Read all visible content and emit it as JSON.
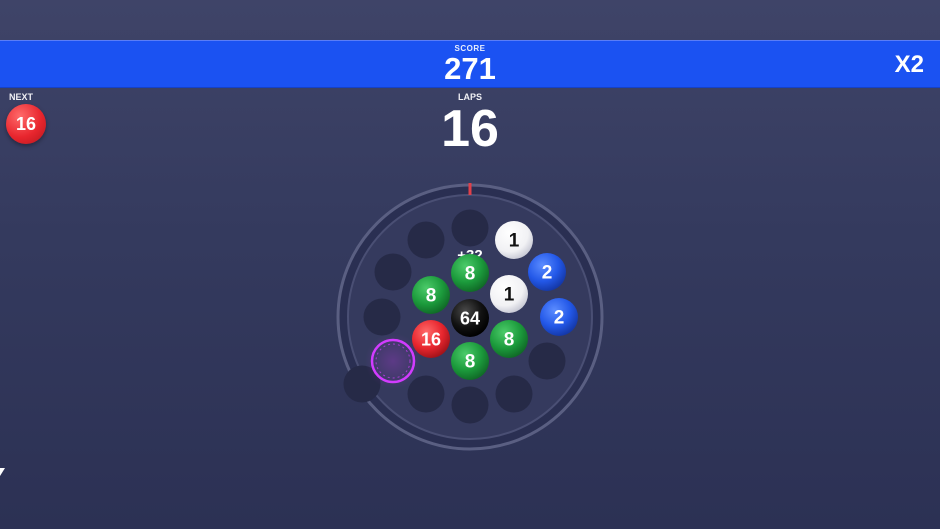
{
  "score": {
    "label": "SCORE",
    "value": "271"
  },
  "multiplier": "X2",
  "next": {
    "label": "NEXT",
    "value": "16",
    "color": "#e8262e"
  },
  "laps": {
    "label": "LAPS",
    "value": "16"
  },
  "bonus_text": "+32",
  "colors": {
    "background": "#363b60",
    "score_bar": "#1b52f2",
    "ball_white": "#ffffff",
    "ball_blue": "#2358e8",
    "ball_green": "#1c9b3c",
    "ball_red": "#e8262e",
    "ball_black": "#111111",
    "ring_glow": "#d23cff",
    "marker": "#e0404a"
  },
  "balls": [
    {
      "label": "1",
      "color": "white"
    },
    {
      "label": "2",
      "color": "blue"
    },
    {
      "label": "8",
      "color": "green"
    },
    {
      "label": "8",
      "color": "green"
    },
    {
      "label": "1",
      "color": "white"
    },
    {
      "label": "64",
      "color": "black"
    },
    {
      "label": "2",
      "color": "blue"
    },
    {
      "label": "16",
      "color": "red"
    },
    {
      "label": "8",
      "color": "green"
    },
    {
      "label": "8",
      "color": "green"
    }
  ]
}
